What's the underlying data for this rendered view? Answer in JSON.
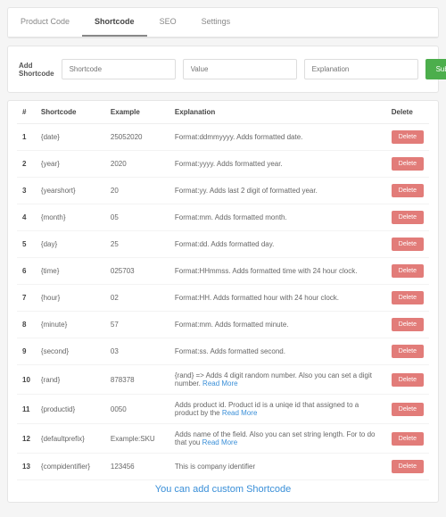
{
  "tabs": [
    {
      "label": "Product Code"
    },
    {
      "label": "Shortcode"
    },
    {
      "label": "SEO"
    },
    {
      "label": "Settings"
    }
  ],
  "form": {
    "title": "Add Shortcode",
    "p1": "Shortcode",
    "p2": "Value",
    "p3": "Explanation",
    "submit": "Submit"
  },
  "headers": {
    "num": "#",
    "sc": "Shortcode",
    "ex": "Example",
    "exp": "Explanation",
    "del": "Delete"
  },
  "deleteLabel": "Delete",
  "readMore": "Read More",
  "rows": [
    {
      "n": "1",
      "sc": "{date}",
      "ex": "25052020",
      "exp": "Format:ddmmyyyy. Adds formatted date."
    },
    {
      "n": "2",
      "sc": "{year}",
      "ex": "2020",
      "exp": "Format:yyyy. Adds formatted year."
    },
    {
      "n": "3",
      "sc": "{yearshort}",
      "ex": "20",
      "exp": "Format:yy. Adds last 2 digit of formatted year."
    },
    {
      "n": "4",
      "sc": "{month}",
      "ex": "05",
      "exp": "Format:mm. Adds formatted month."
    },
    {
      "n": "5",
      "sc": "{day}",
      "ex": "25",
      "exp": "Format:dd. Adds formatted day."
    },
    {
      "n": "6",
      "sc": "{time}",
      "ex": "025703",
      "exp": "Format:HHmmss. Adds formatted time with 24 hour clock."
    },
    {
      "n": "7",
      "sc": "{hour}",
      "ex": "02",
      "exp": "Format:HH. Adds formatted hour with 24 hour clock."
    },
    {
      "n": "8",
      "sc": "{minute}",
      "ex": "57",
      "exp": "Format:mm. Adds formatted minute."
    },
    {
      "n": "9",
      "sc": "{second}",
      "ex": "03",
      "exp": "Format:ss. Adds formatted second."
    },
    {
      "n": "10",
      "sc": "{rand}",
      "ex": "878378",
      "exp": "{rand} => Adds 4 digit random number. Also you can set a digit number.",
      "rm": true
    },
    {
      "n": "11",
      "sc": "{productid}",
      "ex": "0050",
      "exp": "Adds product id. Product id is a uniqe id that assigned to a product by the",
      "rm": true
    },
    {
      "n": "12",
      "sc": "{defaultprefix}",
      "ex": "Example:SKU",
      "exp": "Adds name of the field. Also you can set string length. For to do that you",
      "rm": true
    },
    {
      "n": "13",
      "sc": "{compidentifier}",
      "ex": "123456",
      "exp": "This is company identifier"
    }
  ],
  "callout": "You can add custom Shortcode"
}
